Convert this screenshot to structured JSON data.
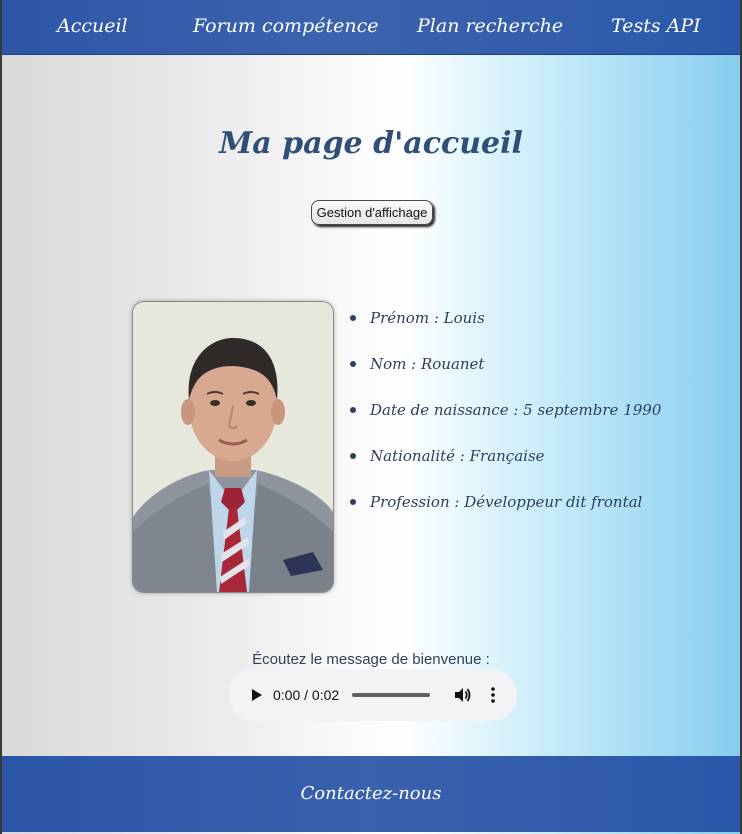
{
  "nav": {
    "items": [
      {
        "label": "Accueil"
      },
      {
        "label": "Forum compétence"
      },
      {
        "label": "Plan recherche"
      },
      {
        "label": "Tests API"
      }
    ]
  },
  "main": {
    "title": "Ma page d'accueil",
    "display_button_label": "Gestion d'affichage",
    "profile": {
      "items": [
        {
          "text": "Prénom : Louis"
        },
        {
          "text": "Nom : Rouanet"
        },
        {
          "text": "Date de naissance : 5 septembre 1990"
        },
        {
          "text": "Nationalité : Française"
        },
        {
          "text": "Profession : Développeur dit frontal"
        }
      ]
    },
    "audio": {
      "caption": "Écoutez le message de bienvenue :",
      "time": "0:00 / 0:02"
    }
  },
  "footer": {
    "contact_label": "Contactez-nous"
  },
  "colors": {
    "nav_background": "#2d56a8",
    "title_text": "#2f4f78",
    "body_text": "#2e3f5c",
    "gradient_end": "#86cdee"
  }
}
